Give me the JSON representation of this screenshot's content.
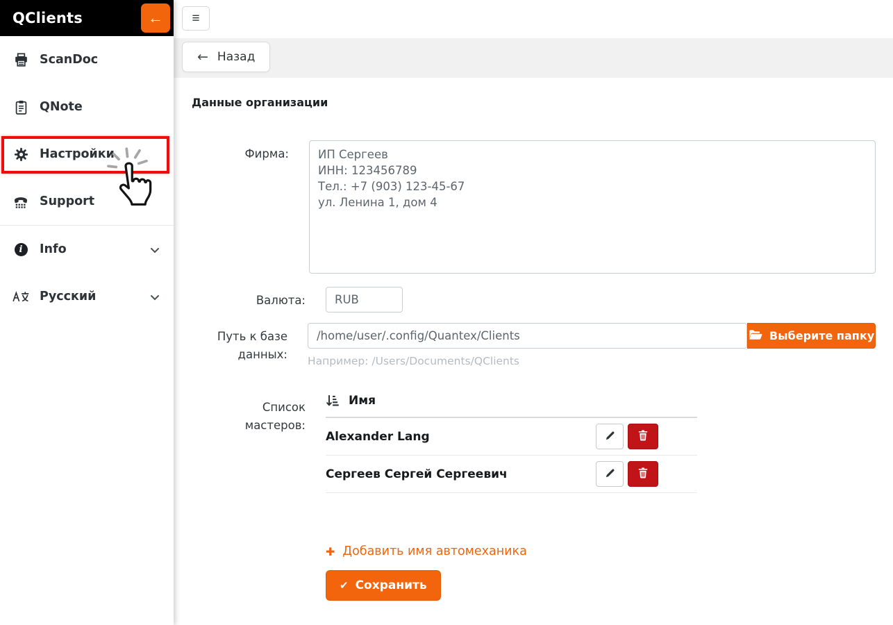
{
  "colors": {
    "accent": "#f2650d",
    "danger": "#c01418",
    "highlight": "#ee0c0c"
  },
  "app": {
    "title": "QClients"
  },
  "icons": {
    "hamburger": "≡",
    "back_arrow": "←",
    "collapse_arrow": "←",
    "check": "✔",
    "plus": "✚",
    "info_glyph": "i"
  },
  "sidebar": {
    "items": [
      {
        "label": "ScanDoc",
        "icon": "printer-icon"
      },
      {
        "label": "QNote",
        "icon": "clipboard-icon"
      },
      {
        "label": "Настройки",
        "icon": "gear-icon",
        "highlighted": true
      },
      {
        "label": "Support",
        "icon": "phone-icon"
      },
      {
        "label": "Info",
        "icon": "info-icon",
        "chevron": true
      },
      {
        "label": "Русский",
        "icon": "language-icon",
        "chevron": true
      }
    ]
  },
  "toolbar": {
    "back_label": "Назад"
  },
  "form": {
    "section_title": "Данные организации",
    "firm": {
      "label": "Фирма:",
      "value": "ИП Сергеев\nИНН: 123456789\nТел.: +7 (903) 123-45-67\nул. Ленина 1, дом 4"
    },
    "currency": {
      "label": "Валюта:",
      "value": "RUB"
    },
    "db_path": {
      "label": "Путь к базе данных:",
      "value": "/home/user/.config/Quantex/Clients",
      "button_label": "Выберите папку",
      "hint": "Например: /Users/Documents/QClients"
    },
    "masters": {
      "label": "Список мастеров:",
      "column_header": "Имя",
      "rows": [
        {
          "name": "Alexander Lang"
        },
        {
          "name": "Сергеев Сергей Сергеевич"
        }
      ]
    },
    "add_link_label": "Добавить имя автомеханика",
    "save_label": "Сохранить"
  }
}
